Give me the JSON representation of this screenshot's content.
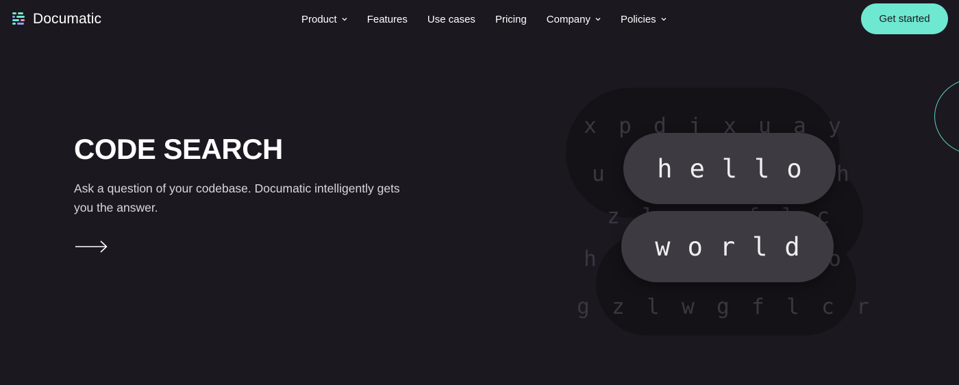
{
  "brand": {
    "name": "Documatic",
    "logo_icon": "documatic-logo-icon",
    "accent_color": "#6ee8d0"
  },
  "nav": {
    "items": [
      {
        "label": "Product",
        "dropdown": true
      },
      {
        "label": "Features",
        "dropdown": false
      },
      {
        "label": "Use cases",
        "dropdown": false
      },
      {
        "label": "Pricing",
        "dropdown": false
      },
      {
        "label": "Company",
        "dropdown": true
      },
      {
        "label": "Policies",
        "dropdown": true
      }
    ],
    "cta_label": "Get started"
  },
  "hero": {
    "title": "CODE SEARCH",
    "description": "Ask a question of your codebase. Documatic intelligently gets you the answer.",
    "arrow_icon": "arrow-right-icon"
  },
  "illustration": {
    "word_top": "hello",
    "word_bottom": "world",
    "letter_rows": [
      "xpdjxuay",
      "u      h",
      "zlwgflc",
      "h      qo",
      "gzlwgflcr"
    ]
  },
  "colors": {
    "background": "#1c1820",
    "pill": "#3e3a41",
    "text": "#ffffff"
  }
}
